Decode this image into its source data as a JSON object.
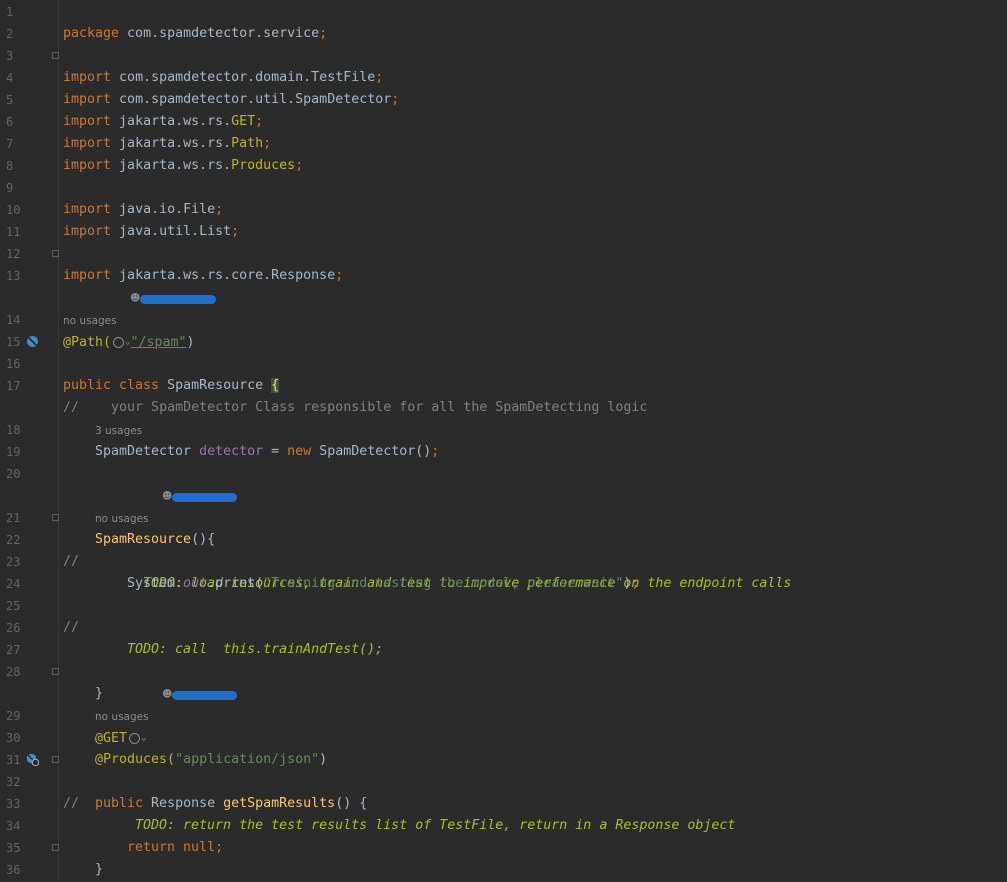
{
  "line_numbers": [
    "1",
    "2",
    "3",
    "4",
    "5",
    "6",
    "7",
    "8",
    "9",
    "10",
    "11",
    "12",
    "13",
    "14",
    "15",
    "16",
    "17",
    "18",
    "19",
    "20",
    "21",
    "22",
    "23",
    "24",
    "25",
    "26",
    "27",
    "28",
    "29",
    "30",
    "31",
    "32",
    "33",
    "34",
    "35",
    "36"
  ],
  "hints": {
    "no_usages": "no usages",
    "three_usages": "3 usages"
  },
  "code": {
    "l1_kw": "package",
    "l1_rest": " com.spamdetector.service",
    "semi": ";",
    "import_kw": "import",
    "l3": " com.spamdetector.domain.TestFile",
    "l4": " com.spamdetector.util.SpamDetector",
    "l5_pre": " jakarta.ws.rs.",
    "l5_ann": "GET",
    "l6_pre": " jakarta.ws.rs.",
    "l6_ann": "Path",
    "l7_pre": " jakarta.ws.rs.",
    "l7_ann": "Produces",
    "l9": " java.io.File",
    "l10": " java.util.List",
    "l12": " jakarta.ws.rs.core.Response",
    "l14_ann": "@Path(",
    "l14_str": "\"/spam\"",
    "l14_close": ")",
    "l15_kw": "public class",
    "l15_name": " SpamResource ",
    "l15_brace": "{",
    "l17": "//    your SpamDetector Class responsible for all the SpamDetecting logic",
    "l18_type": "SpamDetector ",
    "l18_field": "detector",
    "l18_eq": " = ",
    "l18_new": "new",
    "l18_rest": " SpamDetector()",
    "l21_fn": "SpamResource",
    "l21_rest": "(){",
    "l22_slash": "//",
    "l22_todo": "TODO: load resources, train and test to improve performance on the endpoint calls",
    "l23_a": "System.",
    "l23_out": "out",
    "l23_b": ".print(",
    "l23_str": "\"Training and testing the model, please wait\"",
    "l23_c": ")",
    "l25_slash": "//",
    "l25_todo": "TODO: call  this.trainAndTest();",
    "l28": "}",
    "l29_ann": "@GET",
    "l30_ann": "@Produces(",
    "l30_str": "\"application/json\"",
    "l30_close": ")",
    "l31_kw": "public",
    "l31_type": " Response ",
    "l31_fn": "getSpamResults",
    "l31_rest": "() {",
    "l32_slash": "//",
    "l32_todo": "TODO: return the test results list of TestFile, return in a Response object",
    "l34_kw": "return",
    "l34_null": " null",
    "l35": "}"
  },
  "colors": {
    "background": "#2b2b2b",
    "keyword": "#cc7832",
    "string": "#6a8759",
    "annotation": "#bbb529",
    "comment": "#808080",
    "todo": "#a8c023",
    "method": "#ffc66d",
    "field": "#9876aa",
    "redaction": "#1f6fd1"
  },
  "icons": [
    "fold-marker-icon",
    "run-gutter-icon",
    "web-endpoint-icon",
    "globe-icon",
    "chevron-down-icon",
    "person-icon"
  ]
}
